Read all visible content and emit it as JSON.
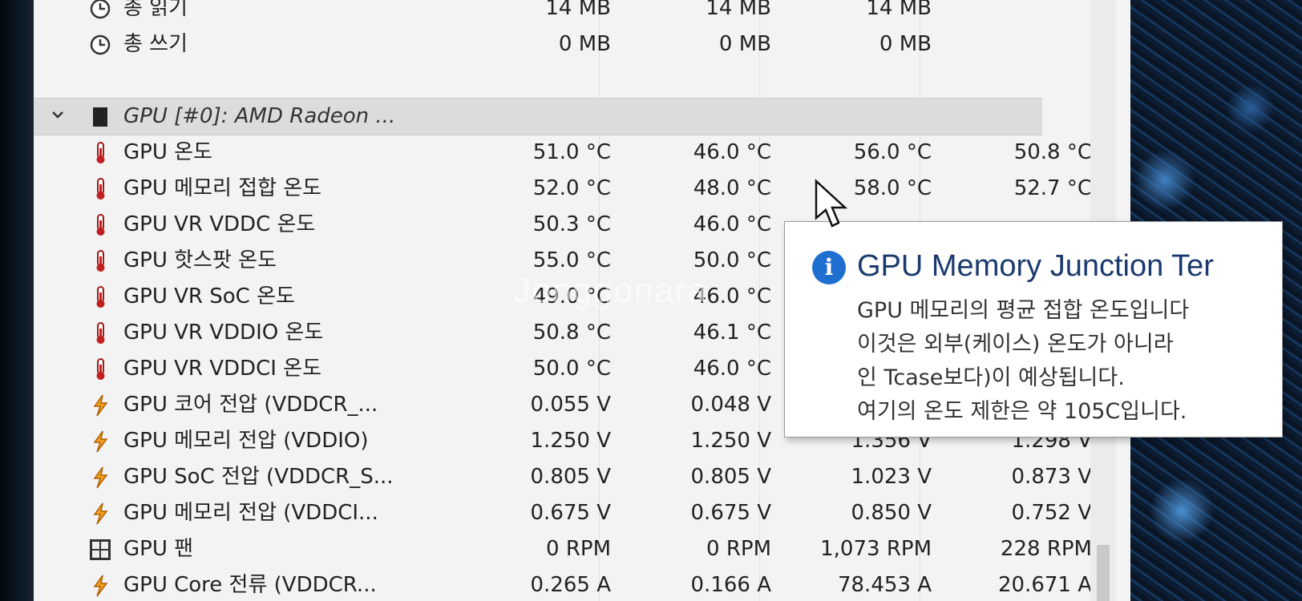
{
  "sensor_rows_top": [
    {
      "label": "총 읽기",
      "values": [
        "14 MB",
        "14 MB",
        "14 MB"
      ],
      "icon": "clock-icon"
    },
    {
      "label": "총 쓰기",
      "values": [
        "0 MB",
        "0 MB",
        "0 MB"
      ],
      "icon": "clock-icon"
    }
  ],
  "gpu_group": {
    "label": "GPU [#0]: AMD Radeon ...",
    "icon": "gpu-chip-icon"
  },
  "gpu_rows": [
    {
      "label": "GPU 온도",
      "values": [
        "51.0 °C",
        "46.0 °C",
        "56.0 °C",
        "50.8 °C"
      ],
      "icon": "thermometer-icon"
    },
    {
      "label": "GPU 메모리 접합 온도",
      "values": [
        "52.0 °C",
        "48.0 °C",
        "58.0 °C",
        "52.7 °C"
      ],
      "icon": "thermometer-icon"
    },
    {
      "label": "GPU VR VDDC 온도",
      "values": [
        "50.3 °C",
        "46.0 °C",
        "",
        ""
      ],
      "icon": "thermometer-icon"
    },
    {
      "label": "GPU 핫스팟 온도",
      "values": [
        "55.0 °C",
        "50.0 °C",
        "",
        ""
      ],
      "icon": "thermometer-icon"
    },
    {
      "label": "GPU VR SoC 온도",
      "values": [
        "49.0 °C",
        "46.0 °C",
        "",
        ""
      ],
      "icon": "thermometer-icon"
    },
    {
      "label": "GPU VR VDDIO 온도",
      "values": [
        "50.8 °C",
        "46.1 °C",
        "",
        ""
      ],
      "icon": "thermometer-icon"
    },
    {
      "label": "GPU VR VDDCI 온도",
      "values": [
        "50.0 °C",
        "46.0 °C",
        "",
        ""
      ],
      "icon": "thermometer-icon"
    },
    {
      "label": "GPU 코어 전압 (VDDCR_...",
      "values": [
        "0.055 V",
        "0.048 V",
        "",
        ""
      ],
      "icon": "voltage-icon"
    },
    {
      "label": "GPU 메모리 전압 (VDDIO)",
      "values": [
        "1.250 V",
        "1.250 V",
        "1.356 V",
        "1.298 V"
      ],
      "icon": "voltage-icon"
    },
    {
      "label": "GPU SoC 전압 (VDDCR_S...",
      "values": [
        "0.805 V",
        "0.805 V",
        "1.023 V",
        "0.873 V"
      ],
      "icon": "voltage-icon"
    },
    {
      "label": "GPU 메모리 전압 (VDDCI...",
      "values": [
        "0.675 V",
        "0.675 V",
        "0.850 V",
        "0.752 V"
      ],
      "icon": "voltage-icon"
    },
    {
      "label": "GPU 팬",
      "values": [
        "0 RPM",
        "0 RPM",
        "1,073 RPM",
        "228 RPM"
      ],
      "icon": "fan-icon"
    },
    {
      "label": "GPU Core 전류 (VDDCR...",
      "values": [
        "0.265 A",
        "0.166 A",
        "78.453 A",
        "20.671 A"
      ],
      "icon": "current-icon"
    }
  ],
  "tooltip": {
    "title": "GPU Memory Junction Ter",
    "lines": [
      "GPU 메모리의 평균 접합 온도입니다",
      "이것은 외부(케이스) 온도가 아니라",
      "인 Tcase보다)이 예상됩니다.",
      "여기의 온도 제한은 약 105C입니다."
    ],
    "icon": "info-icon"
  },
  "watermark": "Jonggonara",
  "colors": {
    "window_bg": "#f3f3f3",
    "group_header_bg": "#dcdcdc",
    "thermo_red": "#c02020",
    "voltage_orange": "#f0a020",
    "info_blue": "#1e6fd0"
  }
}
